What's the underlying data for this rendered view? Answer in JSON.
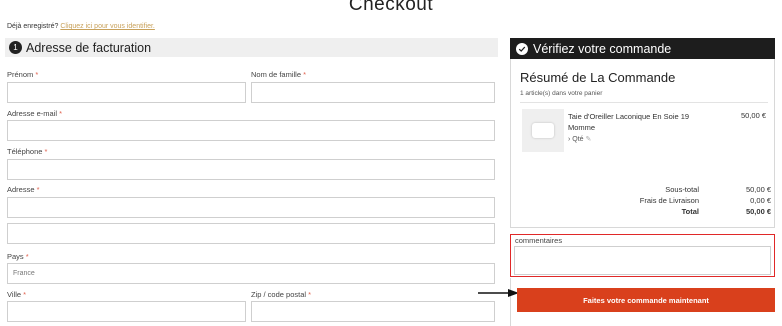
{
  "page": {
    "title": "Checkout"
  },
  "login_prompt": {
    "text": "Déjà enregistré?",
    "link": "Cliquez ici pour vous identifier."
  },
  "billing": {
    "step": "1",
    "title": "Adresse de facturation",
    "fields": {
      "first_name": {
        "label": "Prénom",
        "required": "*",
        "value": ""
      },
      "last_name": {
        "label": "Nom de famille",
        "required": "*",
        "value": ""
      },
      "email": {
        "label": "Adresse e-mail",
        "required": "*",
        "value": ""
      },
      "phone": {
        "label": "Téléphone",
        "required": "*",
        "value": ""
      },
      "address": {
        "label": "Adresse",
        "required": "*",
        "value": ""
      },
      "address2": {
        "value": ""
      },
      "country": {
        "label": "Pays",
        "required": "*",
        "value": "France"
      },
      "city": {
        "label": "Ville",
        "required": "*",
        "value": ""
      },
      "zip": {
        "label": "Zip / code postal",
        "required": "*",
        "value": ""
      }
    }
  },
  "review": {
    "title": "Vérifiez votre commande",
    "summary_title": "Résumé de La Commande",
    "cart_count": "1 article(s) dans votre panier",
    "item": {
      "name": "Taie d'Oreiller Laconique En Soie 19 Momme",
      "qty_label": "Qté",
      "price": "50,00 €"
    },
    "totals": {
      "subtotal_label": "Sous-total",
      "subtotal_value": "50,00 €",
      "shipping_label": "Frais de Livraison",
      "shipping_value": "0,00 €",
      "total_label": "Total",
      "total_value": "50,00 €"
    }
  },
  "comments": {
    "label": "commentaires",
    "value": ""
  },
  "order_button": {
    "label": "Faites votre commande maintenant"
  },
  "colors": {
    "accent": "#d9401c",
    "highlight": "#e02828",
    "link": "#c8a15a",
    "required": "#e0604d"
  },
  "icons": {
    "step": "step-number-icon",
    "check": "check-circle-icon",
    "arrow": "arrow-right-icon"
  }
}
